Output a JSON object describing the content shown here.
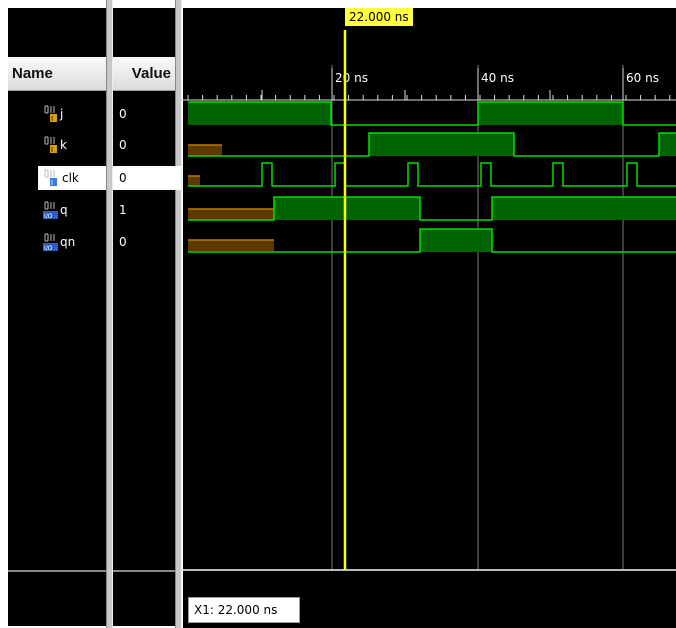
{
  "columns": {
    "name_header": "Name",
    "value_header": "Value"
  },
  "signals": [
    {
      "name": "j",
      "value": "0",
      "icon": "bit-icon-yellow"
    },
    {
      "name": "k",
      "value": "0",
      "icon": "bit-icon-yellow"
    },
    {
      "name": "clk",
      "value": "0",
      "icon": "bit-icon-blue",
      "selected": true
    },
    {
      "name": "q",
      "value": "1",
      "icon": "io-bit-icon"
    },
    {
      "name": "qn",
      "value": "0",
      "icon": "io-bit-icon"
    }
  ],
  "timeline": {
    "tick_labels": [
      "20 ns",
      "40 ns",
      "60 ns"
    ],
    "cursor_label": "22.000 ns",
    "x1_readout": "X1: 22.000 ns"
  },
  "colors": {
    "signal": "#00e000",
    "fill": "#006400",
    "undefined": "#c07800",
    "cursor": "#ffff00",
    "grid": "#7a7a7a"
  }
}
